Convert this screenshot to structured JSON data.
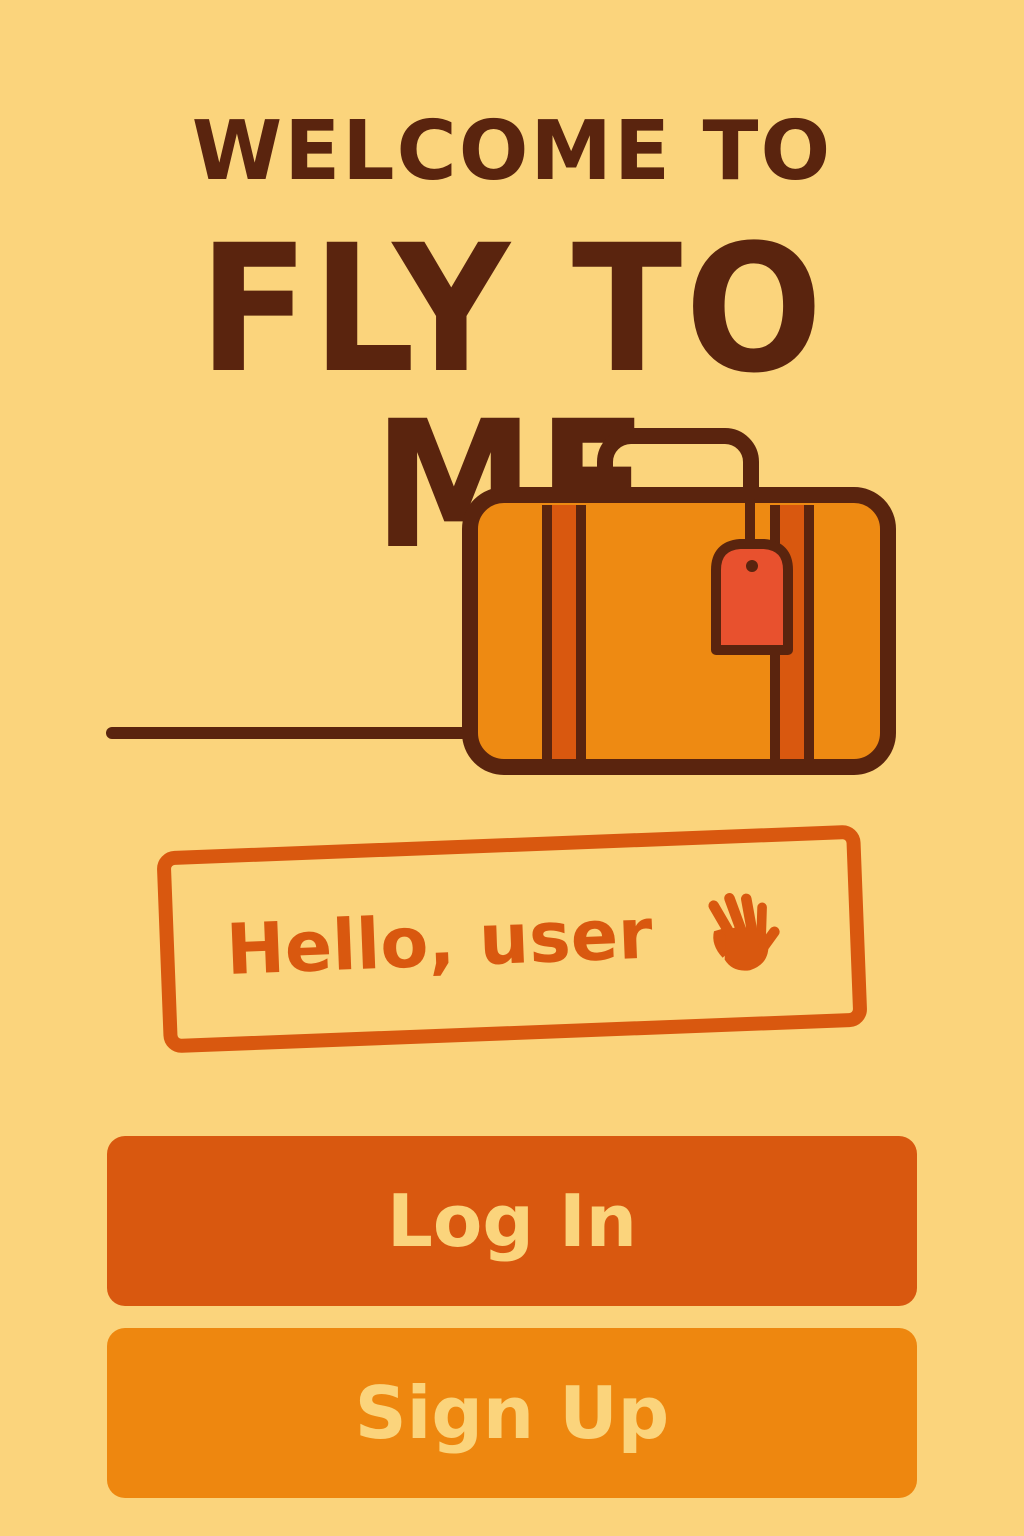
{
  "header": {
    "welcome_line": "WELCOME TO",
    "app_name": "FLY TO ME"
  },
  "illustration": {
    "icon": "suitcase-icon",
    "tag_icon": "luggage-tag-icon"
  },
  "greeting": {
    "text": "Hello, user",
    "icon": "waving-hand-icon"
  },
  "actions": {
    "login_label": "Log In",
    "signup_label": "Sign Up"
  },
  "colors": {
    "background": "#fbd47c",
    "text_dark": "#5a240e",
    "accent_dark_orange": "#d9580f",
    "accent_orange": "#ee870f",
    "suitcase_body": "#ee8a12",
    "tag": "#e8512e"
  }
}
